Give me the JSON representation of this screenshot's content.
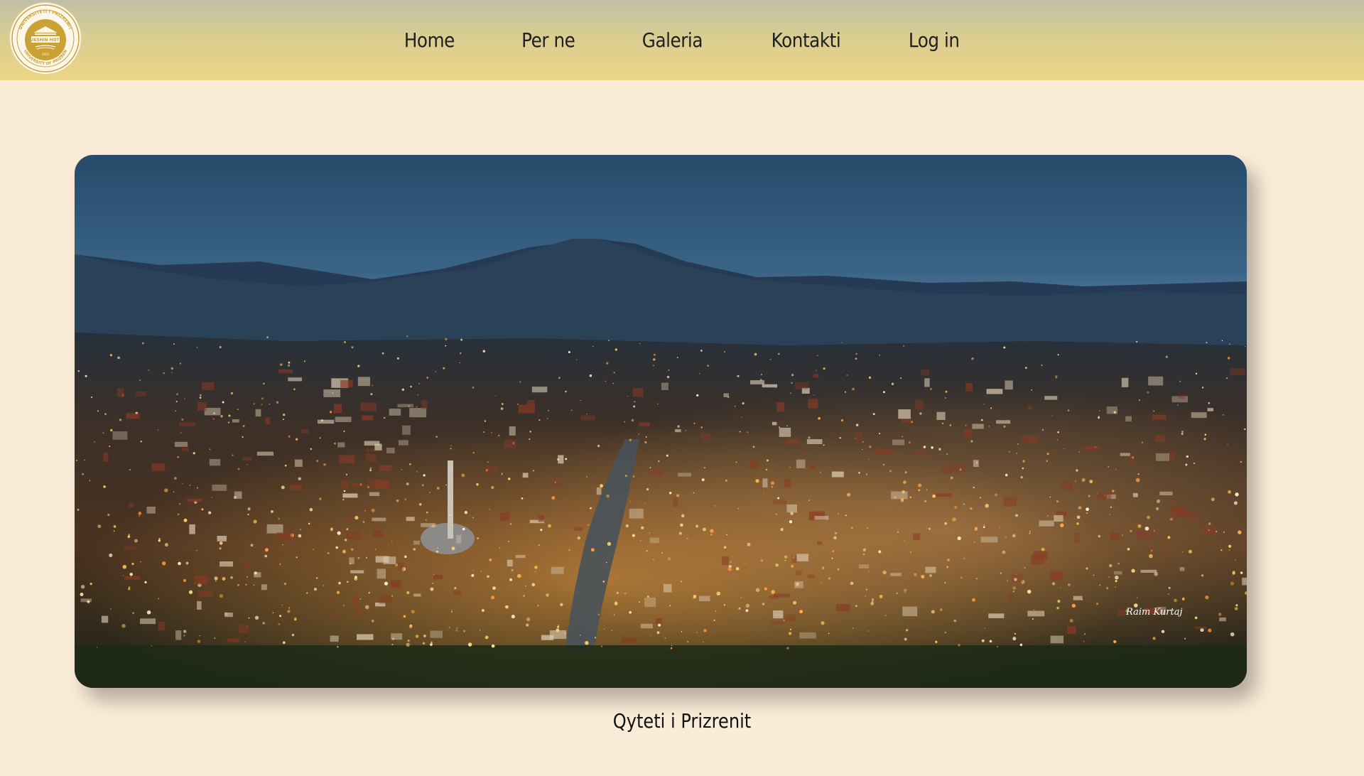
{
  "header": {
    "logo": {
      "icon": "university-seal-icon",
      "ring_top_text": "UNIVERSITETI I PRIZRENIT",
      "ring_bottom_text": "UNIVERSITY OF PRIZREN",
      "center_text": "UKSHIN HOTI",
      "year": "2010",
      "accent_color": "#c9a135"
    },
    "nav": [
      {
        "label": "Home"
      },
      {
        "label": "Per ne"
      },
      {
        "label": "Galeria"
      },
      {
        "label": "Kontakti"
      },
      {
        "label": "Log in"
      }
    ]
  },
  "main": {
    "hero_image": {
      "subject": "night-city-panorama",
      "watermark": "Raim Kurtaj"
    },
    "caption": "Qyteti i Prizrenit"
  },
  "colors": {
    "page_background": "#fbecd8",
    "header_gradient_top": "#c0bfa6",
    "header_gradient_bottom": "#ecd584",
    "text": "#1f1f1f"
  }
}
